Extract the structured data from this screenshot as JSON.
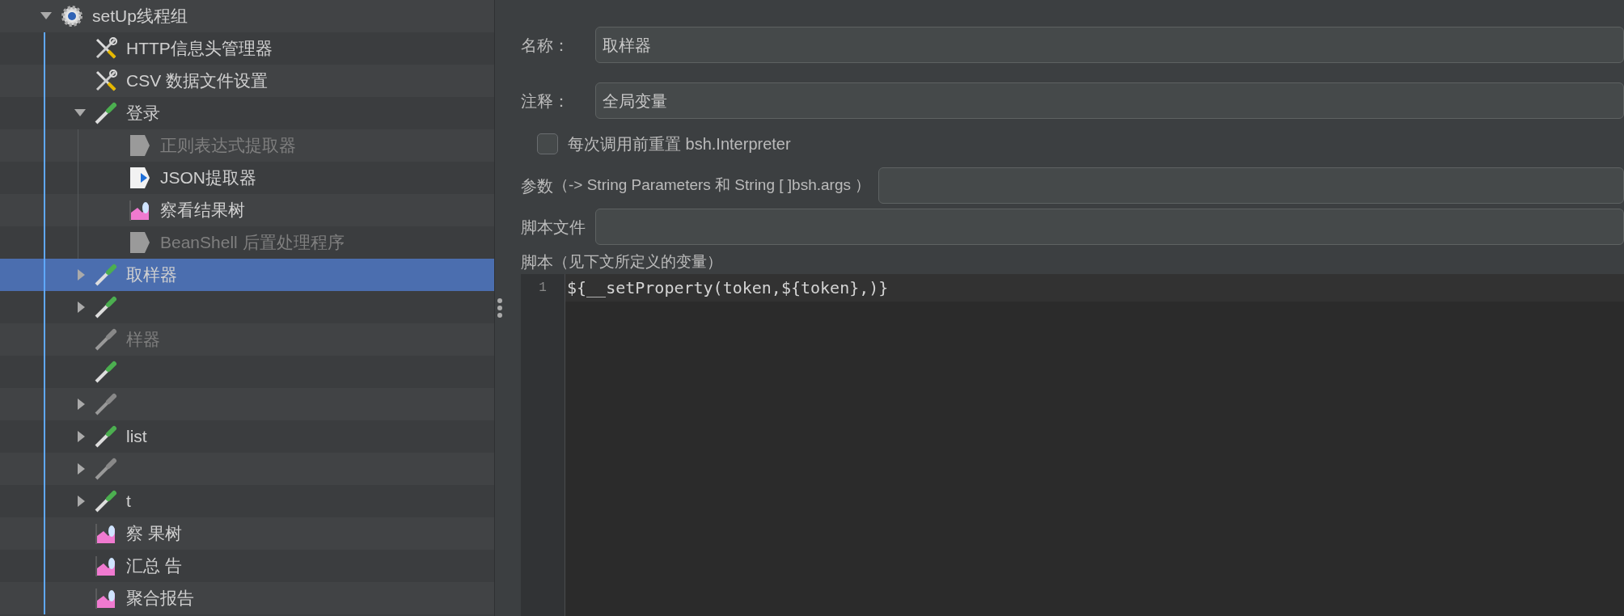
{
  "tree": [
    {
      "label": "setUp线程组",
      "kind": "thread-group",
      "expanded": true,
      "selected": false,
      "disabled": false,
      "children": [
        {
          "label": "HTTP信息头管理器",
          "kind": "config",
          "selected": false,
          "disabled": false
        },
        {
          "label": "CSV 数据文件设置",
          "kind": "config",
          "selected": false,
          "disabled": false
        },
        {
          "label": "登录",
          "kind": "sampler",
          "expanded": true,
          "selected": false,
          "disabled": false,
          "children": [
            {
              "label": "正则表达式提取器",
              "kind": "postprocessor",
              "selected": false,
              "disabled": true
            },
            {
              "label": "JSON提取器",
              "kind": "extractor",
              "selected": false,
              "disabled": false
            },
            {
              "label": "察看结果树",
              "kind": "listener",
              "selected": false,
              "disabled": false
            },
            {
              "label": "BeanShell 后置处理程序",
              "kind": "postprocessor",
              "selected": false,
              "disabled": true
            }
          ]
        },
        {
          "label": "取样器",
          "kind": "sampler",
          "expanded": false,
          "selected": true,
          "disabled": false
        },
        {
          "kind": "sampler",
          "expanded": false,
          "selected": false,
          "disabled": false
        },
        {
          "label": "样器",
          "kind": "sampler",
          "selected": false,
          "disabled": true
        },
        {
          "kind": "sampler",
          "selected": false,
          "disabled": false
        },
        {
          "kind": "sampler",
          "expanded": false,
          "selected": false,
          "disabled": true
        },
        {
          "label": "list",
          "kind": "sampler",
          "expanded": false,
          "selected": false,
          "disabled": false
        },
        {
          "kind": "sampler",
          "expanded": false,
          "selected": false,
          "disabled": true
        },
        {
          "label": "t",
          "kind": "sampler",
          "expanded": false,
          "selected": false,
          "disabled": false
        },
        {
          "label": "察 果树",
          "kind": "listener",
          "selected": false,
          "disabled": false
        },
        {
          "label": "汇总 告",
          "kind": "listener",
          "selected": false,
          "disabled": false
        },
        {
          "label": "聚合报告",
          "kind": "listener",
          "selected": false,
          "disabled": false
        }
      ]
    }
  ],
  "panel": {
    "name": {
      "label": "名称：",
      "value": "取样器"
    },
    "comment": {
      "label": "注释：",
      "value": "全局变量"
    },
    "reset": {
      "label": "每次调用前重置 bsh.Interpreter",
      "checked": false
    },
    "params": {
      "label": "参数",
      "hint": "（-> String Parameters 和 String [ ]bsh.args ）"
    },
    "script_file": {
      "label": "脚本文件"
    },
    "script": {
      "label": "脚本",
      "hint": "（见下文所定义的变量）",
      "lines": [
        {
          "number": "1",
          "code": "${__setProperty(token,${token},)}"
        }
      ]
    }
  }
}
